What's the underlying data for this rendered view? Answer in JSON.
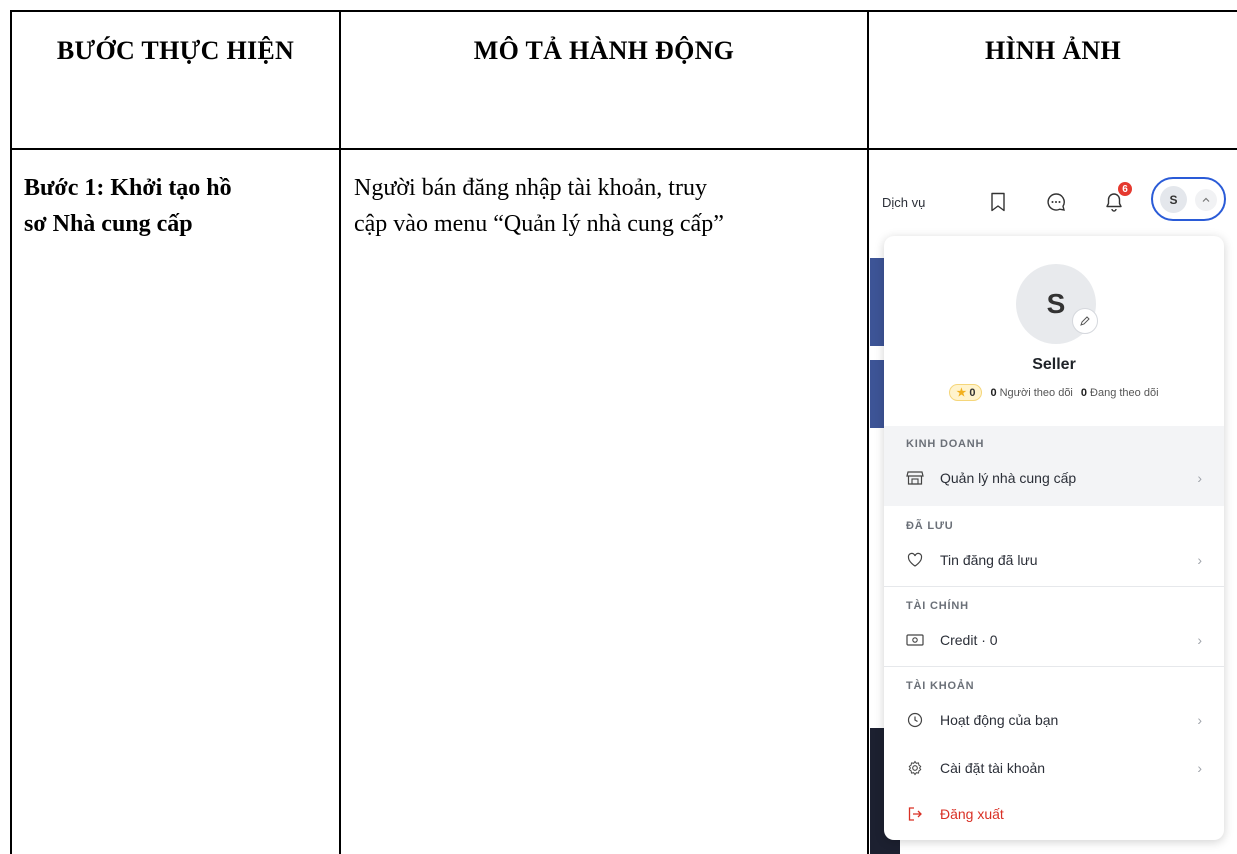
{
  "table": {
    "headers": [
      "BƯỚC THỰC HIỆN",
      "MÔ TẢ HÀNH ĐỘNG",
      "HÌNH ẢNH"
    ],
    "row1": {
      "step_line1": "Bước 1: Khởi tạo hồ",
      "step_line2": "sơ Nhà cung cấp",
      "desc_line1": "Người bán đăng nhập tài khoản, truy",
      "desc_line2": "cập vào menu “Quản lý nhà cung cấp”"
    }
  },
  "screenshot": {
    "topbar": {
      "service_label": "Dịch vụ",
      "notification_count": "6",
      "user_initial": "S"
    },
    "profile": {
      "initial": "S",
      "name": "Seller",
      "rating": "0",
      "followers_count": "0",
      "followers_label": "Người theo dõi",
      "following_count": "0",
      "following_label": "Đang theo dõi"
    },
    "sections": {
      "business": {
        "title": "KINH DOANH",
        "item": "Quản lý nhà cung cấp"
      },
      "saved": {
        "title": "ĐÃ LƯU",
        "item": "Tin đăng đã lưu"
      },
      "finance": {
        "title": "TÀI CHÍNH",
        "item": "Credit · 0"
      },
      "account": {
        "title": "TÀI KHOẢN",
        "item_activity": "Hoạt động của bạn",
        "item_settings": "Cài đặt tài khoản"
      }
    },
    "logout_label": "Đăng xuất",
    "colors": {
      "accent": "#2a5bd7",
      "badge": "#e5392f",
      "logout": "#d93025",
      "highlight_row": "#f3f4f6"
    }
  }
}
